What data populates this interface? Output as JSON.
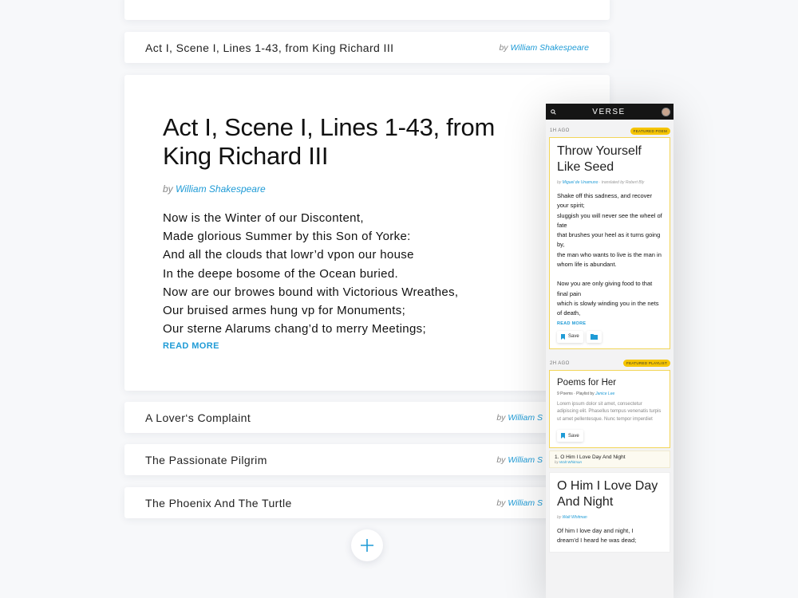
{
  "top_item": {
    "title": "Act I, Scene I, Lines 1-43, from King Richard III",
    "by": "by",
    "author": "William Shakespeare"
  },
  "featured": {
    "title": "Act I, Scene I, Lines 1-43, from King Richard III",
    "by": "by",
    "author": "William Shakespeare",
    "lines": [
      "Now is the Winter of our Discontent,",
      "Made glorious Summer by this Son of Yorke:",
      "And all the clouds that lowr’d vpon our house",
      "In the deepe bosome of the Ocean buried.",
      "Now are our browes bound with Victorious Wreathes,",
      "Our bruised armes hung vp for Monuments;",
      "Our sterne Alarums chang’d to merry Meetings;"
    ],
    "read_more": "READ MORE"
  },
  "list": [
    {
      "title": "A Lover‘s Complaint",
      "by": "by",
      "author": "William S"
    },
    {
      "title": "The Passionate Pilgrim",
      "by": "by",
      "author": "William S"
    },
    {
      "title": "The Phoenix And The Turtle",
      "by": "by",
      "author": "William S"
    }
  ],
  "add_button": {
    "icon": "plus-icon"
  },
  "phone": {
    "logo": "VERSE",
    "card1": {
      "ago": "1H AGO",
      "tag": "FEATURED POEM",
      "title": "Throw Yourself Like Seed",
      "by": "by",
      "author": "Miguel de Unamuno",
      "translated": "· translated by Robert Bly",
      "lines": [
        "Shake off this sadness, and recover your spirit;",
        "sluggish you will never see the wheel of fate",
        "that brushes your heel as it turns going by,",
        "the man who wants to live is the man in whom life is abundant.",
        "",
        "Now you are only giving food to that final pain",
        "which is slowly winding you in the nets of death,"
      ],
      "read_more": "READ MORE",
      "save": "Save"
    },
    "card2": {
      "ago": "2H AGO",
      "tag": "FEATURED PLAYLIST",
      "title": "Poems for Her",
      "meta": "9 Poems · Playlist by",
      "curator": "Janice Lee",
      "desc": "Lorem ipsum dolor sit amet, consectetur adipiscing elit. Phasellus tempus venenatis turpis ut amet pellentesque. Nunc tempor imperdiet",
      "save": "Save",
      "item": "1. O Him I Love Day And Night",
      "item_by": "by",
      "item_author": "Walt Whitman"
    },
    "card3": {
      "title": "O Him I Love Day And Night",
      "by": "by",
      "author": "Walt Whitman",
      "lines": [
        "Of him I love day and night, I",
        "dream’d I heard he was dead;"
      ]
    }
  }
}
